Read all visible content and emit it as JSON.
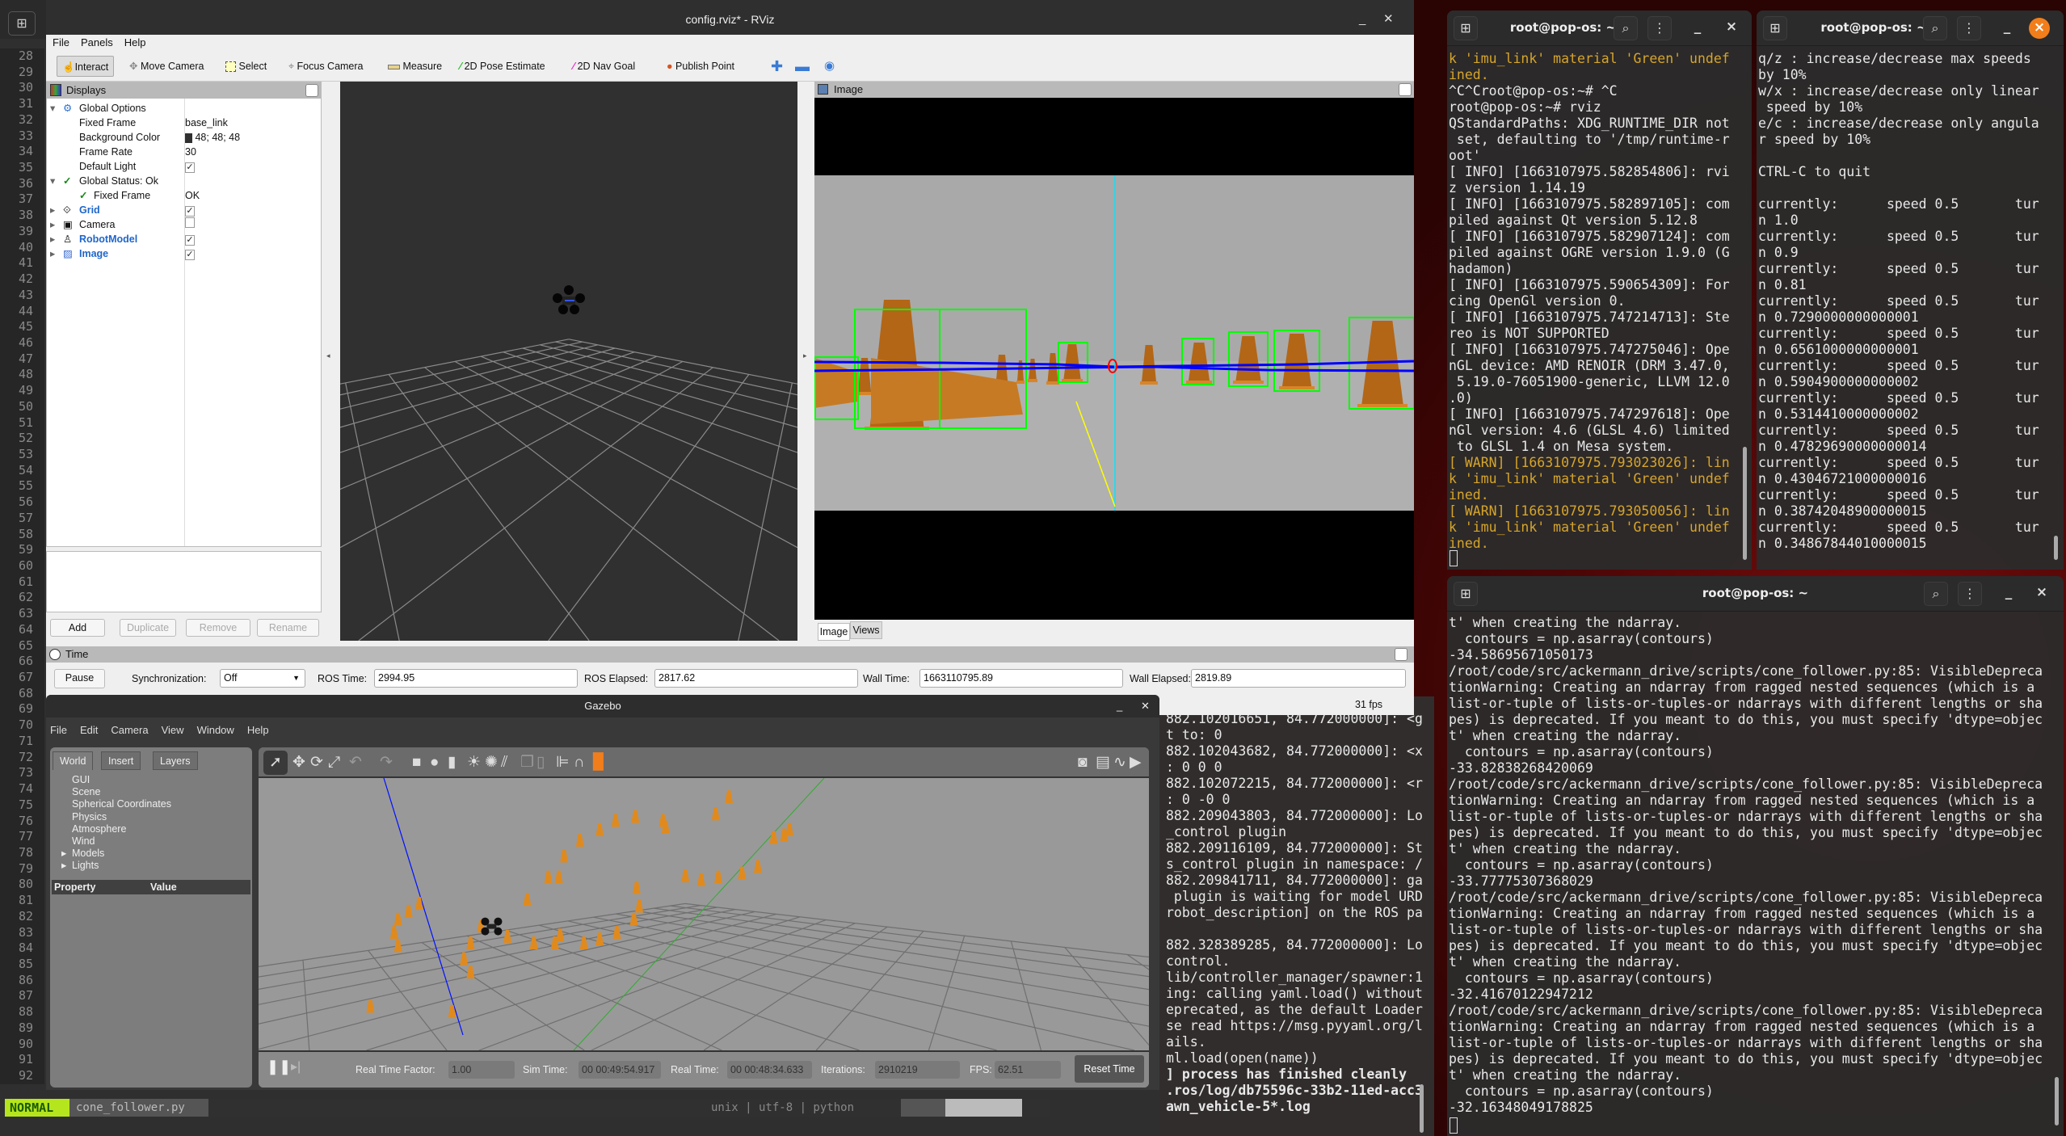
{
  "vim": {
    "line_numbers": [
      "28",
      "29",
      "30",
      "31",
      "32",
      "33",
      "34",
      "35",
      "36",
      "37",
      "38",
      "39",
      "40",
      "41",
      "42",
      "43",
      "44",
      "45",
      "46",
      "47",
      "48",
      "49",
      "50",
      "51",
      "52",
      "53",
      "54",
      "55",
      "56",
      "57",
      "58",
      "59",
      "60",
      "61",
      "62",
      "63",
      "64",
      "65",
      "66",
      "67",
      "68",
      "69",
      "70",
      "71",
      "72",
      "73",
      "74",
      "75",
      "76",
      "77",
      "78",
      "79",
      "80",
      "81",
      "82",
      "83",
      "84",
      "85",
      "86",
      "87",
      "88",
      "89",
      "90",
      "91",
      "92"
    ],
    "mode": "NORMAL",
    "filename": "cone_follower.py",
    "fileinfo": "unix | utf-8 | python"
  },
  "rviz": {
    "title": "config.rviz* - RViz",
    "menu": [
      "File",
      "Panels",
      "Help"
    ],
    "tools": [
      "Interact",
      "Move Camera",
      "Select",
      "Focus Camera",
      "Measure",
      "2D Pose Estimate",
      "2D Nav Goal",
      "Publish Point"
    ],
    "displays": {
      "title": "Displays",
      "global_options": "Global Options",
      "fixed_frame_label": "Fixed Frame",
      "fixed_frame_value": "base_link",
      "bg_color_label": "Background Color",
      "bg_color_value": "48; 48; 48",
      "frame_rate_label": "Frame Rate",
      "frame_rate_value": "30",
      "default_light_label": "Default Light",
      "global_status": "Global Status: Ok",
      "status_fixed_frame": "Fixed Frame",
      "status_fixed_frame_value": "OK",
      "items": [
        "Grid",
        "Camera",
        "RobotModel",
        "Image"
      ],
      "checked": [
        true,
        false,
        true,
        true
      ]
    },
    "buttons": {
      "add": "Add",
      "duplicate": "Duplicate",
      "remove": "Remove",
      "rename": "Rename"
    },
    "image_panel": {
      "title": "Image",
      "tabs": [
        "Image",
        "Views"
      ]
    },
    "time": {
      "title": "Time",
      "pause": "Pause",
      "sync_label": "Synchronization:",
      "sync_value": "Off",
      "ros_time_label": "ROS Time:",
      "ros_time": "2994.95",
      "ros_elapsed_label": "ROS Elapsed:",
      "ros_elapsed": "2817.62",
      "wall_time_label": "Wall Time:",
      "wall_time": "1663110795.89",
      "wall_elapsed_label": "Wall Elapsed:",
      "wall_elapsed": "2819.89"
    },
    "fps": "31 fps"
  },
  "gazebo": {
    "title": "Gazebo",
    "menu": [
      "File",
      "Edit",
      "Camera",
      "View",
      "Window",
      "Help"
    ],
    "tabs": [
      "World",
      "Insert",
      "Layers"
    ],
    "tree": [
      "GUI",
      "Scene",
      "Spherical Coordinates",
      "Physics",
      "Atmosphere",
      "Wind",
      "Models",
      "Lights"
    ],
    "prop_header": "Property",
    "value_header": "Value",
    "bottom": {
      "rtf_label": "Real Time Factor:",
      "rtf": "1.00",
      "sim_label": "Sim Time:",
      "sim": "00 00:49:54.917",
      "real_label": "Real Time:",
      "real": "00 00:48:34.633",
      "iter_label": "Iterations:",
      "iter": "2910219",
      "fps_label": "FPS:",
      "fps": "62.51",
      "reset": "Reset Time"
    }
  },
  "mid_terminal": {
    "lines": [
      {
        "t": "882.102016651, 84.772000000]: <g"
      },
      {
        "t": "t to: 0"
      },
      {
        "t": "882.102043682, 84.772000000]: <x"
      },
      {
        "t": ": 0 0 0"
      },
      {
        "t": "882.102072215, 84.772000000]: <r"
      },
      {
        "t": ": 0 -0 0"
      },
      {
        "t": "882.209043803, 84.772000000]: Lo"
      },
      {
        "t": "_control plugin"
      },
      {
        "t": "882.209116109, 84.772000000]: St"
      },
      {
        "t": "s_control plugin in namespace: /"
      },
      {
        "t": "882.209841711, 84.772000000]: ga"
      },
      {
        "t": " plugin is waiting for model URD"
      },
      {
        "t": "robot_description] on the ROS pa"
      },
      {
        "t": ""
      },
      {
        "t": "882.328389285, 84.772000000]: Lo"
      },
      {
        "t": "control."
      },
      {
        "t": "lib/controller_manager/spawner:1"
      },
      {
        "t": "ing: calling yaml.load() without"
      },
      {
        "t": "eprecated, as the default Loader"
      },
      {
        "t": "se read https://msg.pyyaml.org/l"
      },
      {
        "t": "ails."
      },
      {
        "t": "ml.load(open(name))"
      },
      {
        "t": "] process has finished cleanly",
        "b": true
      },
      {
        "t": ".ros/log/db75596c-33b2-11ed-acc3",
        "b": true
      },
      {
        "t": "awn_vehicle-5*.log",
        "b": true
      }
    ]
  },
  "term_rviz": {
    "title": "root@pop-os: ~",
    "lines": [
      {
        "t": "k 'imu_link' material 'Green' undef",
        "w": true
      },
      {
        "t": "ined.",
        "w": true
      },
      {
        "t": "^C^Croot@pop-os:~# ^C"
      },
      {
        "t": "root@pop-os:~# rviz"
      },
      {
        "t": "QStandardPaths: XDG_RUNTIME_DIR not"
      },
      {
        "t": " set, defaulting to '/tmp/runtime-r"
      },
      {
        "t": "oot'"
      },
      {
        "t": "[ INFO] [1663107975.582854806]: rvi"
      },
      {
        "t": "z version 1.14.19"
      },
      {
        "t": "[ INFO] [1663107975.582897105]: com"
      },
      {
        "t": "piled against Qt version 5.12.8"
      },
      {
        "t": "[ INFO] [1663107975.582907124]: com"
      },
      {
        "t": "piled against OGRE version 1.9.0 (G"
      },
      {
        "t": "hadamon)"
      },
      {
        "t": "[ INFO] [1663107975.590654309]: For"
      },
      {
        "t": "cing OpenGl version 0."
      },
      {
        "t": "[ INFO] [1663107975.747214713]: Ste"
      },
      {
        "t": "reo is NOT SUPPORTED"
      },
      {
        "t": "[ INFO] [1663107975.747275046]: Ope"
      },
      {
        "t": "nGL device: AMD RENOIR (DRM 3.47.0,"
      },
      {
        "t": " 5.19.0-76051900-generic, LLVM 12.0"
      },
      {
        "t": ".0)"
      },
      {
        "t": "[ INFO] [1663107975.747297618]: Ope"
      },
      {
        "t": "nGl version: 4.6 (GLSL 4.6) limited"
      },
      {
        "t": " to GLSL 1.4 on Mesa system."
      },
      {
        "t": "[ WARN] [1663107975.793023026]: lin",
        "w": true
      },
      {
        "t": "k 'imu_link' material 'Green' undef",
        "w": true
      },
      {
        "t": "ined.",
        "w": true
      },
      {
        "t": "[ WARN] [1663107975.793050056]: lin",
        "w": true
      },
      {
        "t": "k 'imu_link' material 'Green' undef",
        "w": true
      },
      {
        "t": "ined.",
        "w": true
      }
    ]
  },
  "term_teleop": {
    "title": "root@pop-os: ~",
    "lines": [
      {
        "t": "q/z : increase/decrease max speeds"
      },
      {
        "t": "by 10%"
      },
      {
        "t": "w/x : increase/decrease only linear"
      },
      {
        "t": " speed by 10%"
      },
      {
        "t": "e/c : increase/decrease only angula"
      },
      {
        "t": "r speed by 10%"
      },
      {
        "t": ""
      },
      {
        "t": "CTRL-C to quit"
      },
      {
        "t": ""
      },
      {
        "t": "currently:      speed 0.5       tur"
      },
      {
        "t": "n 1.0"
      },
      {
        "t": "currently:      speed 0.5       tur"
      },
      {
        "t": "n 0.9"
      },
      {
        "t": "currently:      speed 0.5       tur"
      },
      {
        "t": "n 0.81"
      },
      {
        "t": "currently:      speed 0.5       tur"
      },
      {
        "t": "n 0.7290000000000001"
      },
      {
        "t": "currently:      speed 0.5       tur"
      },
      {
        "t": "n 0.6561000000000001"
      },
      {
        "t": "currently:      speed 0.5       tur"
      },
      {
        "t": "n 0.5904900000000002"
      },
      {
        "t": "currently:      speed 0.5       tur"
      },
      {
        "t": "n 0.5314410000000002"
      },
      {
        "t": "currently:      speed 0.5       tur"
      },
      {
        "t": "n 0.47829690000000014"
      },
      {
        "t": "currently:      speed 0.5       tur"
      },
      {
        "t": "n 0.43046721000000016"
      },
      {
        "t": "currently:      speed 0.5       tur"
      },
      {
        "t": "n 0.38742048900000015"
      },
      {
        "t": "currently:      speed 0.5       tur"
      },
      {
        "t": "n 0.34867844010000015"
      }
    ]
  },
  "term_follower": {
    "title": "root@pop-os: ~",
    "lines": [
      {
        "t": "t' when creating the ndarray."
      },
      {
        "t": "  contours = np.asarray(contours)"
      },
      {
        "t": "-34.58695671050173"
      },
      {
        "t": "/root/code/src/ackermann_drive/scripts/cone_follower.py:85: VisibleDepreca"
      },
      {
        "t": "tionWarning: Creating an ndarray from ragged nested sequences (which is a"
      },
      {
        "t": "list-or-tuple of lists-or-tuples-or ndarrays with different lengths or sha"
      },
      {
        "t": "pes) is deprecated. If you meant to do this, you must specify 'dtype=objec"
      },
      {
        "t": "t' when creating the ndarray."
      },
      {
        "t": "  contours = np.asarray(contours)"
      },
      {
        "t": "-33.82838268420069"
      },
      {
        "t": "/root/code/src/ackermann_drive/scripts/cone_follower.py:85: VisibleDepreca"
      },
      {
        "t": "tionWarning: Creating an ndarray from ragged nested sequences (which is a"
      },
      {
        "t": "list-or-tuple of lists-or-tuples-or ndarrays with different lengths or sha"
      },
      {
        "t": "pes) is deprecated. If you meant to do this, you must specify 'dtype=objec"
      },
      {
        "t": "t' when creating the ndarray."
      },
      {
        "t": "  contours = np.asarray(contours)"
      },
      {
        "t": "-33.77775307368029"
      },
      {
        "t": "/root/code/src/ackermann_drive/scripts/cone_follower.py:85: VisibleDepreca"
      },
      {
        "t": "tionWarning: Creating an ndarray from ragged nested sequences (which is a"
      },
      {
        "t": "list-or-tuple of lists-or-tuples-or ndarrays with different lengths or sha"
      },
      {
        "t": "pes) is deprecated. If you meant to do this, you must specify 'dtype=objec"
      },
      {
        "t": "t' when creating the ndarray."
      },
      {
        "t": "  contours = np.asarray(contours)"
      },
      {
        "t": "-32.41670122947212"
      },
      {
        "t": "/root/code/src/ackermann_drive/scripts/cone_follower.py:85: VisibleDepreca"
      },
      {
        "t": "tionWarning: Creating an ndarray from ragged nested sequences (which is a"
      },
      {
        "t": "list-or-tuple of lists-or-tuples-or ndarrays with different lengths or sha"
      },
      {
        "t": "pes) is deprecated. If you meant to do this, you must specify 'dtype=objec"
      },
      {
        "t": "t' when creating the ndarray."
      },
      {
        "t": "  contours = np.asarray(contours)"
      },
      {
        "t": "-32.16348049178825"
      }
    ]
  },
  "colors": {
    "warn": "#d6a52a",
    "accent_close": "#f27e1b",
    "bbox": "#00ff00",
    "cone": "#c46f1c",
    "link_blue": "#1f66c9"
  }
}
